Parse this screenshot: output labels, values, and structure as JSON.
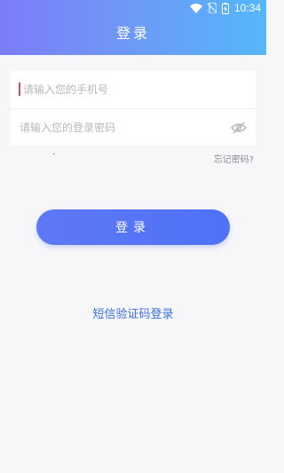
{
  "status_bar": {
    "time": "10:34",
    "icons": [
      "wifi-icon",
      "no-sim-icon",
      "battery-icon"
    ]
  },
  "header": {
    "title": "登录"
  },
  "form": {
    "phone_placeholder": "请输入您的手机号",
    "password_placeholder": "请输入您的登录密码",
    "password_visibility_icon": "eye-off-icon"
  },
  "links": {
    "forgot_password": "忘记密码?",
    "sms_login": "短信验证码登录"
  },
  "actions": {
    "login_label": "登录"
  },
  "colors": {
    "header_gradient_start": "#7d7cf8",
    "header_gradient_end": "#54b7fb",
    "button_primary": "#4f72f7",
    "link_blue": "#3b6fdc",
    "cursor_pink": "#e0457a",
    "background": "#f7f7f9"
  }
}
